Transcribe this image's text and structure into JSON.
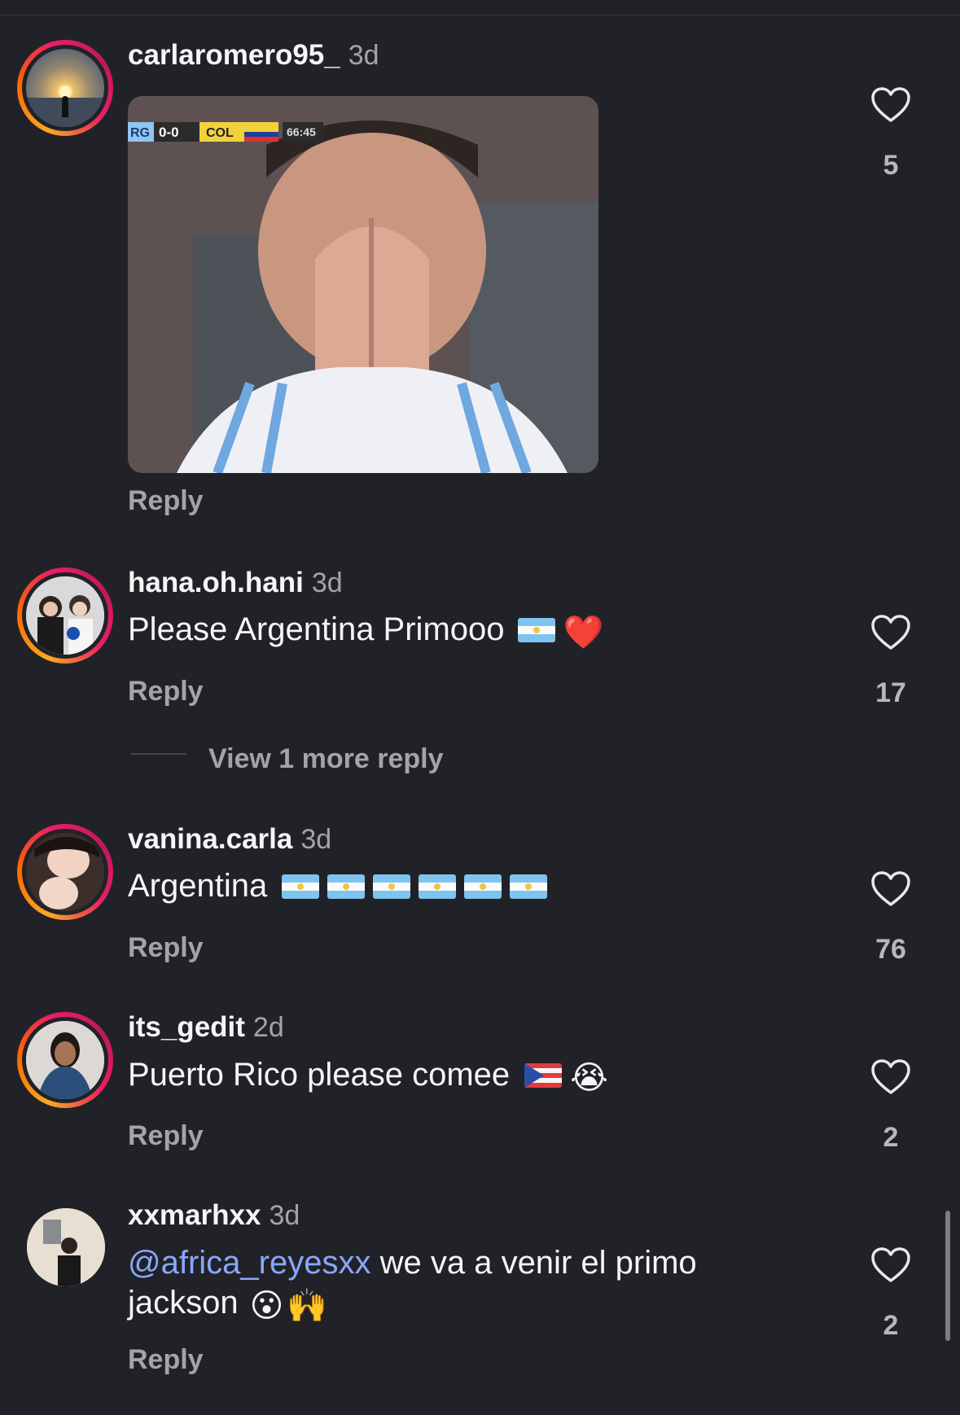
{
  "comments": [
    {
      "username": "carlaromero95_",
      "time": "3d",
      "text": "",
      "reply": "Reply",
      "likes": "5",
      "gif": {
        "score_left": "RG",
        "score": "0-0",
        "score_right": "COL",
        "clock": "66:45"
      }
    },
    {
      "username": "hana.oh.hani",
      "time": "3d",
      "text": "Please Argentina Primooo",
      "reply": "Reply",
      "likes": "17",
      "emoji_heart": "❤️"
    },
    {
      "username": "vanina.carla",
      "time": "3d",
      "text": "Argentina",
      "reply": "Reply",
      "likes": "76"
    },
    {
      "username": "its_gedit",
      "time": "2d",
      "text": "Puerto Rico please comee",
      "reply": "Reply",
      "likes": "2",
      "emoji_cry": "😭"
    },
    {
      "username": "xxmarhxx",
      "time": "3d",
      "mention": "@africa_reyesxx",
      "text": " we va a venir el primo",
      "text2": "jackson",
      "reply": "Reply",
      "likes": "2",
      "emoji_wow": "😮",
      "emoji_hands": "🙌"
    }
  ],
  "view_more": "View 1 more reply",
  "icons": {
    "like": "heart-outline-icon"
  },
  "colors": {
    "background": "#212227",
    "mention": "#8aa7ff",
    "muted": "#a3a4a9"
  }
}
